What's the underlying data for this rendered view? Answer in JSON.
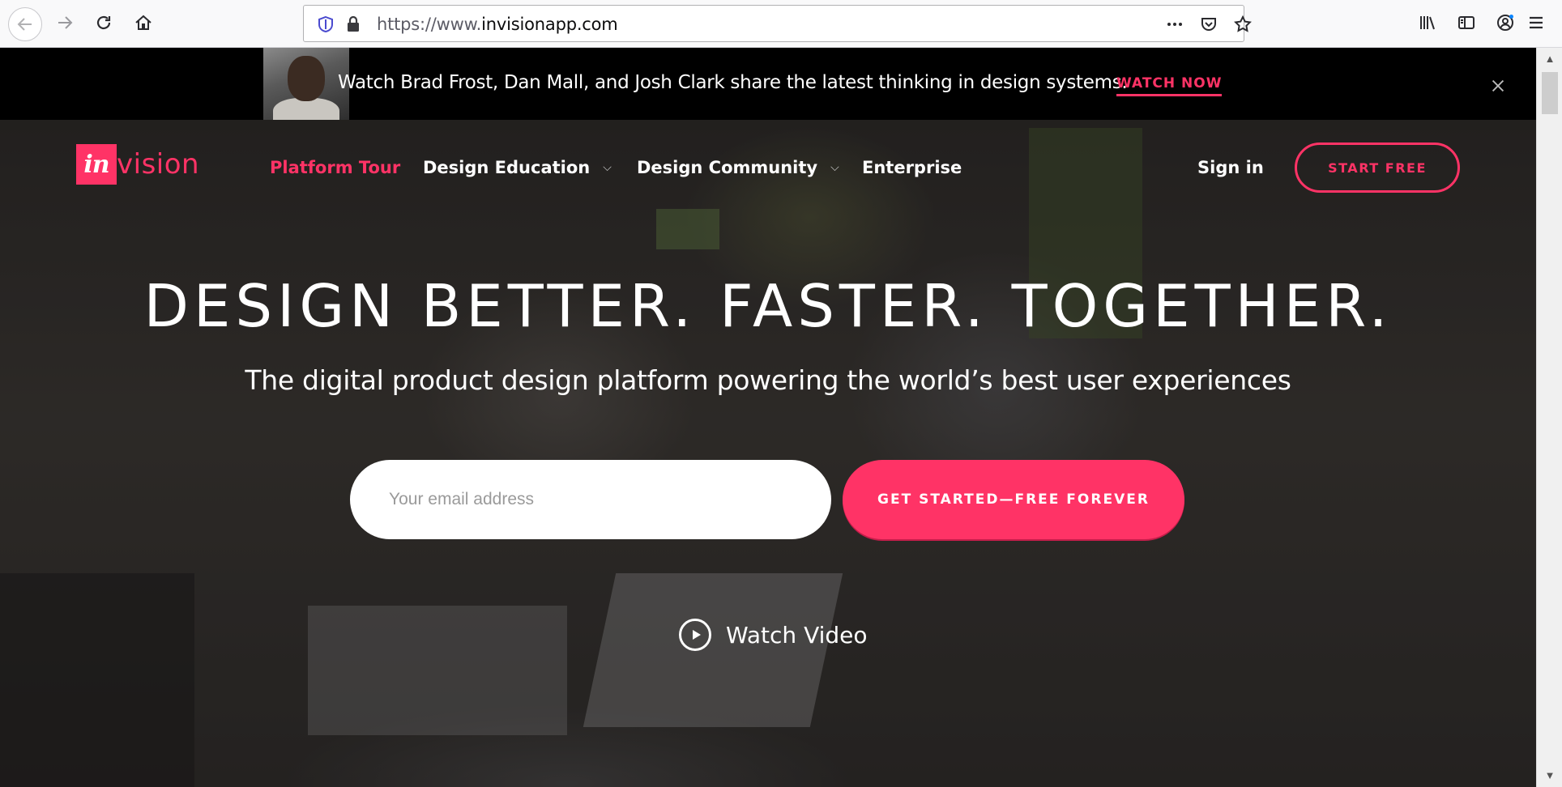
{
  "browser": {
    "url_prefix": "https://www.",
    "url_domain": "invisionapp.com",
    "icons": [
      "back-icon",
      "forward-icon",
      "reload-icon",
      "home-icon",
      "shield-icon",
      "lock-icon",
      "more-icon",
      "pocket-icon",
      "bookmark-star-icon",
      "library-icon",
      "sidebar-icon",
      "account-icon",
      "menu-icon"
    ]
  },
  "banner": {
    "text": "Watch Brad Frost, Dan Mall, and Josh Clark share the latest thinking in design systems.",
    "cta": "WATCH NOW",
    "close_symbol": "×"
  },
  "nav": {
    "logo_in": "in",
    "logo_word": "vision",
    "items": [
      {
        "label": "Platform Tour",
        "active": true
      },
      {
        "label": "Design Education",
        "chevron": "⌵"
      },
      {
        "label": "Design Community",
        "chevron": "⌵"
      },
      {
        "label": "Enterprise"
      }
    ],
    "signin": "Sign in",
    "start_free": "START FREE"
  },
  "hero": {
    "headline": "DESIGN BETTER. FASTER. TOGETHER.",
    "subhead": "The digital product design platform powering the world’s best user experiences",
    "email_placeholder": "Your email address",
    "cta": "GET STARTED—FREE FOREVER",
    "watch_video": "Watch Video"
  },
  "colors": {
    "brand": "#ff3366",
    "banner_bg": "#000000"
  }
}
